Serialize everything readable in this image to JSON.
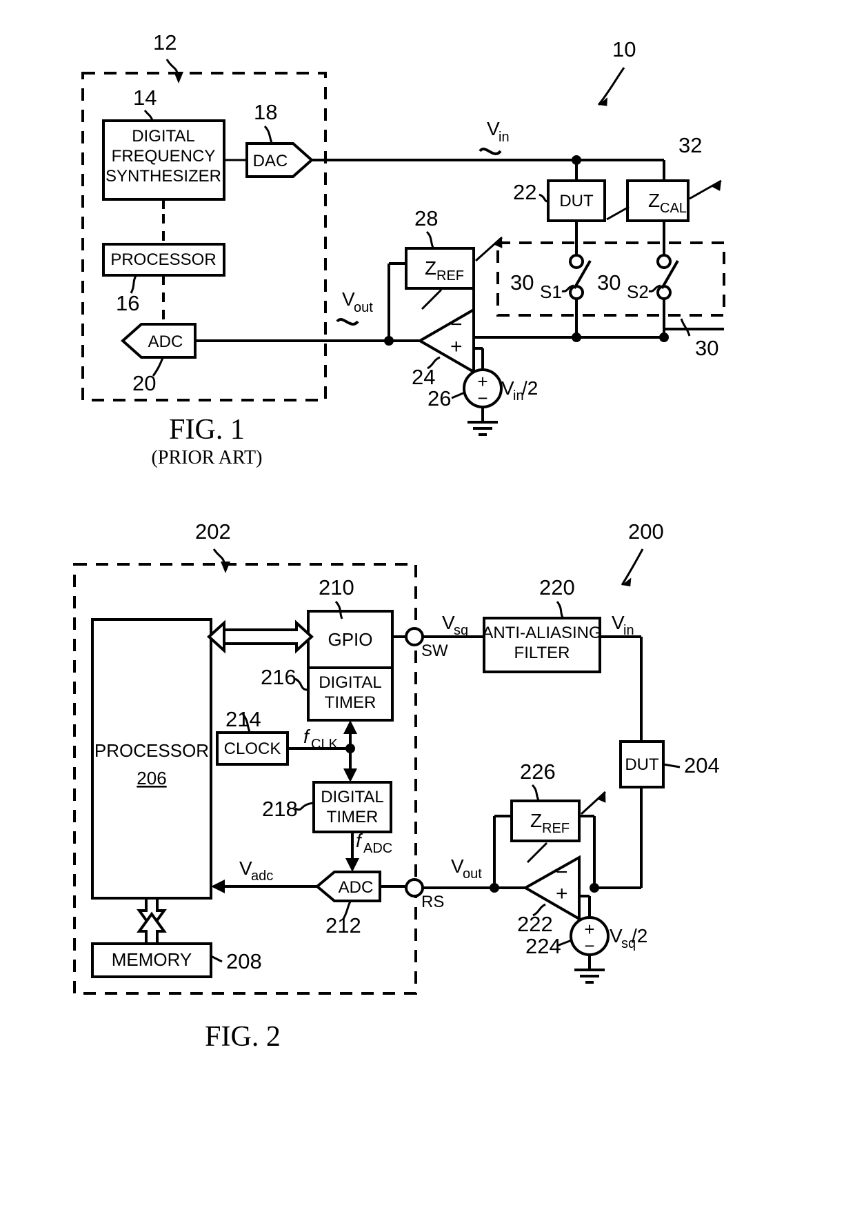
{
  "figures": [
    {
      "id": "fig1",
      "caption": "FIG. 1",
      "subcaption": "(PRIOR ART)",
      "system_ref": "10",
      "enclosure_ref": "12",
      "blocks": {
        "dfs": {
          "label_line1": "DIGITAL",
          "label_line2": "FREQUENCY",
          "label_line3": "SYNTHESIZER",
          "ref": "14"
        },
        "dac": {
          "label": "DAC",
          "ref": "18"
        },
        "processor": {
          "label": "PROCESSOR",
          "ref": "16"
        },
        "adc": {
          "label": "ADC",
          "ref": "20"
        },
        "dut": {
          "label": "DUT",
          "ref": "22"
        },
        "zcal": {
          "label": "Z",
          "sublabel": "CAL",
          "ref": "32"
        },
        "zref": {
          "label": "Z",
          "sublabel": "REF",
          "ref": "28"
        },
        "opamp": {
          "ref": "24",
          "minus": "−",
          "plus": "+"
        },
        "source": {
          "ref": "26",
          "label": "V",
          "sublabel": "in",
          "suffix": "/2",
          "plus": "+",
          "minus": "−"
        },
        "switchbank": {
          "ref": "30",
          "s1_ref": "30",
          "s1_label": "S1",
          "s2_ref": "30",
          "s2_label": "S2"
        }
      },
      "signals": {
        "vin": {
          "base": "V",
          "sub": "in"
        },
        "vout": {
          "base": "V",
          "sub": "out"
        }
      }
    },
    {
      "id": "fig2",
      "caption": "FIG. 2",
      "system_ref": "200",
      "enclosure_ref": "202",
      "blocks": {
        "processor": {
          "label": "PROCESSOR",
          "ref": "206"
        },
        "memory": {
          "label": "MEMORY",
          "ref": "208"
        },
        "gpio": {
          "label": "GPIO",
          "ref": "210"
        },
        "timer216": {
          "label_line1": "DIGITAL",
          "label_line2": "TIMER",
          "ref": "216"
        },
        "timer218": {
          "label_line1": "DIGITAL",
          "label_line2": "TIMER",
          "ref": "218"
        },
        "clock": {
          "label": "CLOCK",
          "ref": "214"
        },
        "adc": {
          "label": "ADC",
          "ref": "212"
        },
        "filter": {
          "label_line1": "ANTI-ALIASING",
          "label_line2": "FILTER",
          "ref": "220"
        },
        "dut": {
          "label": "DUT",
          "ref": "204"
        },
        "zref": {
          "label": "Z",
          "sublabel": "REF",
          "ref": "226"
        },
        "opamp": {
          "ref": "222",
          "minus": "−",
          "plus": "+"
        },
        "source": {
          "ref": "224",
          "label": "V",
          "sublabel": "sq",
          "suffix": "/2",
          "plus": "+",
          "minus": "−"
        }
      },
      "terminals": {
        "sw": "SW",
        "rs": "RS"
      },
      "signals": {
        "vsq": {
          "base": "V",
          "sub": "sq"
        },
        "vin": {
          "base": "V",
          "sub": "in"
        },
        "vout": {
          "base": "V",
          "sub": "out"
        },
        "vadc": {
          "base": "V",
          "sub": "adc"
        },
        "fclk": {
          "base": "f",
          "sub": "CLK"
        },
        "fadc": {
          "base": "f",
          "sub": "ADC"
        }
      }
    }
  ]
}
